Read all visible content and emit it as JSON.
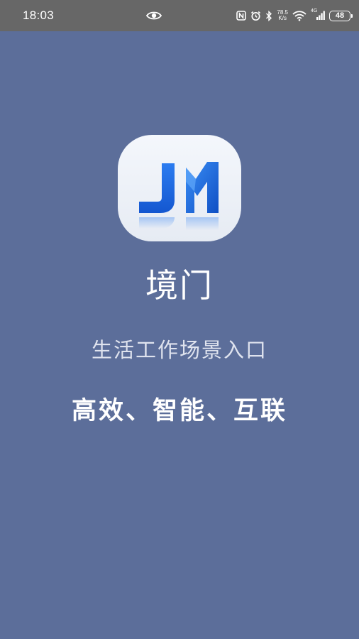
{
  "status_bar": {
    "time": "18:03",
    "net_speed_value": "78.5",
    "net_speed_unit": "K/s",
    "signal_type": "4G",
    "battery": "48"
  },
  "splash": {
    "logo_text": "JM",
    "app_name": "境门",
    "tagline": "生活工作场景入口",
    "slogan": "高效、智能、互联"
  },
  "colors": {
    "background": "#5c6e9a",
    "status_bar": "#676767",
    "logo_blue": "#1a6be0"
  },
  "icons": [
    "eye-icon",
    "nfc-icon",
    "alarm-icon",
    "bluetooth-icon",
    "wifi-icon",
    "signal-icon",
    "battery-icon"
  ]
}
